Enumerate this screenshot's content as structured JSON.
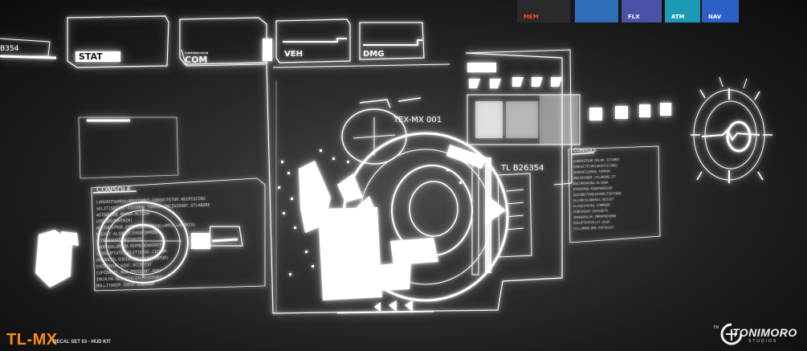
{
  "hud": {
    "id_label": "TL B26354",
    "left_edge_code": "B354",
    "labels": {
      "stat": "STAT",
      "com": "COM",
      "com_small": "COMMUNICATION",
      "veh": "VEH",
      "dmg": "DMG",
      "tex": "TEX-MX 001",
      "console_left": "CONSOLE",
      "console_right": "CONSOLE"
    },
    "chips": [
      {
        "label": "MEM",
        "text_color": "#ff4a1a",
        "bg": "#2a2a2c"
      },
      {
        "label": "",
        "text_color": "#ffffff",
        "bg": "#2c6fb8"
      },
      {
        "label": "FLX",
        "text_color": "#ffffff",
        "bg": "#4a52a8"
      },
      {
        "label": "ATM",
        "text_color": "#ffffff",
        "bg": "#1d9ab3"
      },
      {
        "label": "NAV",
        "text_color": "#ffffff",
        "bg": "#2d5fc8"
      }
    ],
    "console_left_lines": [
      "LOREMIPSUMDOLORSITAMET.CONSECTETUR.ADIPISCING",
      "$ELIT[SEDDO] EIUSMOD TEMPOR.INCIDIDUNT.UTLABORE",
      "#ETDOLORE MAGNA.ALIQUA",
      "UTENIM(ADMINIM)",
      "QUISNOSTRUD.EXERCITATION{ULLAMCO.LABORIS}",
      "NISIUT.ALIQUIP.EXEACOMMODO",
      "$CONSEQUAT.DUISAUTE",
      "IRUREDOLOR.IN.REPREHENDERIT",
      "INVOLUPTATE[VELIT]ESSE.CILLUM",
      "DOLOREEU.FUGIATNULLA(PARIATUR)",
      "EXCEPTEUR.SINT.OCCAECAT",
      "CUPIDATAT.NON.PROIDENT.SUNT",
      "INCULPA.QUIOFFICIA{DESERUNT}",
      "MOLLITANIM.IDEST.LABORUM"
    ],
    "console_right_lines": [
      "LOREMIPSUM.DOLOR.SITAMET",
      "CONSECTETUR[ADIPISCING]",
      "SEDDOEIUSMOD.TEMPOR",
      "INCIDIDUNT.UTLABORE.ET",
      "DOLOREMAGNA.ALIQUA",
      "UTENIMAD.MINIMVENIAM",
      "QUISNOSTRUD{EXERCITATION}",
      "ULLAMCOLABORIS.NISIUT",
      "ALIQUIPEXEA.COMMODO",
      "CONSEQUAT.DUISAUTE",
      "IRUREDOLOR.INREPREHEND",
      "VOLUPTATEVELIT.ESSE",
      "CILLUMDOLORE.EUFUGIAT"
    ]
  },
  "brand": {
    "title": "TL-MX",
    "subtitle": "DECAL SET 03 - HUD KIT",
    "title_color": "#ff8a1e",
    "studio_name": "TONIMORO",
    "studio_sub": "STUDIOS",
    "studio_tm": "TM"
  }
}
